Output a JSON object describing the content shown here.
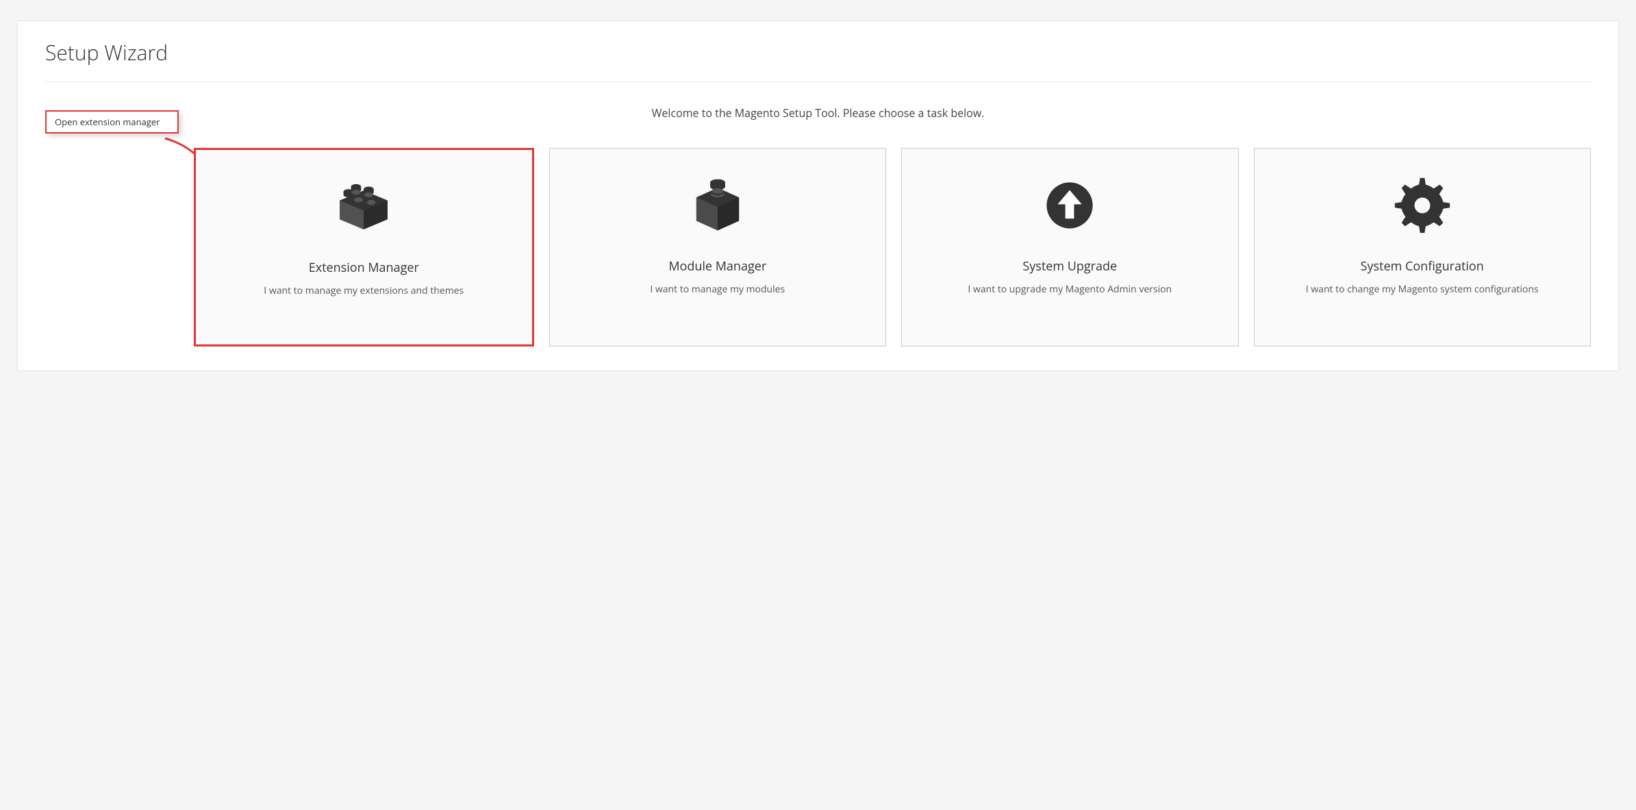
{
  "page": {
    "title": "Setup Wizard",
    "welcome": "Welcome to the Magento Setup Tool. Please choose a task below."
  },
  "annotation": {
    "callout": "Open extension manager"
  },
  "cards": [
    {
      "title": "Extension Manager",
      "description": "I want to manage my extensions and themes",
      "icon": "lego-brick-icon"
    },
    {
      "title": "Module Manager",
      "description": "I want to manage my modules",
      "icon": "cube-icon"
    },
    {
      "title": "System Upgrade",
      "description": "I want to upgrade my Magento Admin version",
      "icon": "arrow-up-circle-icon"
    },
    {
      "title": "System Configuration",
      "description": "I want to change my Magento system configurations",
      "icon": "gear-icon"
    }
  ]
}
